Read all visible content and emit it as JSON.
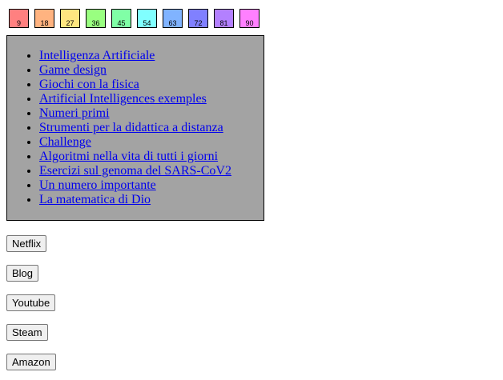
{
  "swatches": [
    {
      "label": "9",
      "color": "#ff8080"
    },
    {
      "label": "18",
      "color": "#ffb380"
    },
    {
      "label": "27",
      "color": "#ffe680"
    },
    {
      "label": "36",
      "color": "#99ff80"
    },
    {
      "label": "45",
      "color": "#80ffa6"
    },
    {
      "label": "54",
      "color": "#80ffff"
    },
    {
      "label": "63",
      "color": "#80b3ff"
    },
    {
      "label": "72",
      "color": "#8080ff"
    },
    {
      "label": "81",
      "color": "#b380ff"
    },
    {
      "label": "90",
      "color": "#ff80ff"
    }
  ],
  "links": [
    "Intelligenza Artificiale",
    "Game design",
    "Giochi con la fisica",
    "Artificial Intelligences exemples",
    "Numeri primi",
    "Strumenti per la didattica a distanza",
    "Challenge",
    "Algoritmi nella vita di tutti i giorni",
    "Esercizi sul genoma del SARS-CoV2",
    "Un numero importante",
    "La matematica di Dio"
  ],
  "buttons": [
    "Netflix",
    "Blog",
    "Youtube",
    "Steam",
    "Amazon"
  ]
}
